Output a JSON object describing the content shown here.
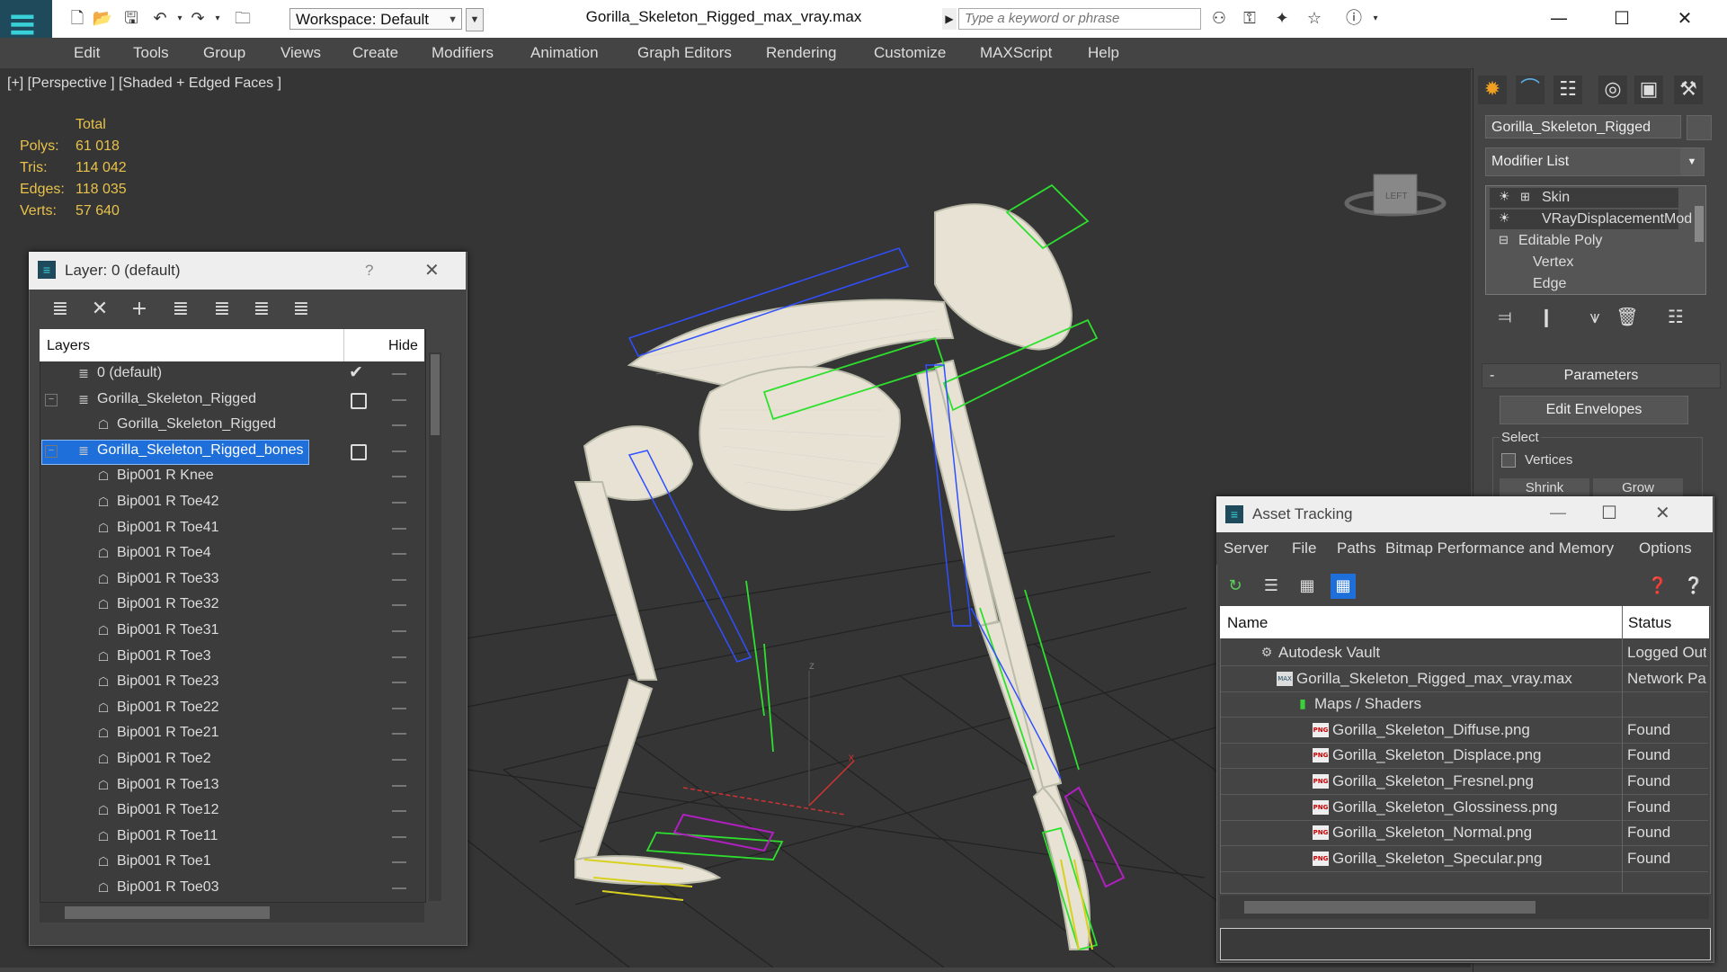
{
  "titlebar": {
    "workspace_label": "Workspace: Default",
    "doc_title": "Gorilla_Skeleton_Rigged_max_vray.max",
    "search_placeholder": "Type a keyword or phrase"
  },
  "menu": [
    "Edit",
    "Tools",
    "Group",
    "Views",
    "Create",
    "Modifiers",
    "Animation",
    "Graph Editors",
    "Rendering",
    "Customize",
    "MAXScript",
    "Help"
  ],
  "viewport": {
    "label": "[+] [Perspective ] [Shaded + Edged Faces ]",
    "stats_header": "Total",
    "stats": [
      {
        "label": "Polys:",
        "value": "61 018"
      },
      {
        "label": "Tris:",
        "value": "114 042"
      },
      {
        "label": "Edges:",
        "value": "118 035"
      },
      {
        "label": "Verts:",
        "value": "57 640"
      }
    ],
    "viewcube_label": "LEFT",
    "axis_z": "z",
    "axis_x": "x"
  },
  "command_panel": {
    "object_name": "Gorilla_Skeleton_Rigged",
    "modifier_list": "Modifier List",
    "stack": [
      "Skin",
      "VRayDisplacementMod",
      "Editable Poly",
      "Vertex",
      "Edge"
    ],
    "parameters_header": "Parameters",
    "edit_envelopes": "Edit Envelopes",
    "select_label": "Select",
    "vertices_label": "Vertices",
    "shrink_label": "Shrink",
    "grow_label": "Grow"
  },
  "layer_panel": {
    "title": "Layer: 0 (default)",
    "help": "?",
    "col_layers": "Layers",
    "col_hide": "Hide",
    "rows": [
      "0 (default)",
      "Gorilla_Skeleton_Rigged",
      "Gorilla_Skeleton_Rigged",
      "Gorilla_Skeleton_Rigged_bones",
      "Bip001 R Knee",
      "Bip001 R Toe42",
      "Bip001 R Toe41",
      "Bip001 R Toe4",
      "Bip001 R Toe33",
      "Bip001 R Toe32",
      "Bip001 R Toe31",
      "Bip001 R Toe3",
      "Bip001 R Toe23",
      "Bip001 R Toe22",
      "Bip001 R Toe21",
      "Bip001 R Toe2",
      "Bip001 R Toe13",
      "Bip001 R Toe12",
      "Bip001 R Toe11",
      "Bip001 R Toe1",
      "Bip001 R Toe03"
    ]
  },
  "asset_tracking": {
    "title": "Asset Tracking",
    "menu": [
      "Server",
      "File",
      "Paths",
      "Bitmap Performance and Memory",
      "Options"
    ],
    "col_name": "Name",
    "col_status": "Status",
    "rows": [
      {
        "name": "Autodesk Vault",
        "status": "Logged Out"
      },
      {
        "name": "Gorilla_Skeleton_Rigged_max_vray.max",
        "status": "Network Path"
      },
      {
        "name": "Maps / Shaders",
        "status": ""
      },
      {
        "name": "Gorilla_Skeleton_Diffuse.png",
        "status": "Found"
      },
      {
        "name": "Gorilla_Skeleton_Displace.png",
        "status": "Found"
      },
      {
        "name": "Gorilla_Skeleton_Fresnel.png",
        "status": "Found"
      },
      {
        "name": "Gorilla_Skeleton_Glossiness.png",
        "status": "Found"
      },
      {
        "name": "Gorilla_Skeleton_Normal.png",
        "status": "Found"
      },
      {
        "name": "Gorilla_Skeleton_Specular.png",
        "status": "Found"
      }
    ],
    "png_badge": "PNG",
    "max_badge": "MAX"
  },
  "colors": {
    "selection": "#1e6fd9",
    "stats_text": "#e8c24a",
    "viewport_bg": "#353535",
    "bones_green": "#2de02d",
    "bones_blue": "#3050ff"
  }
}
